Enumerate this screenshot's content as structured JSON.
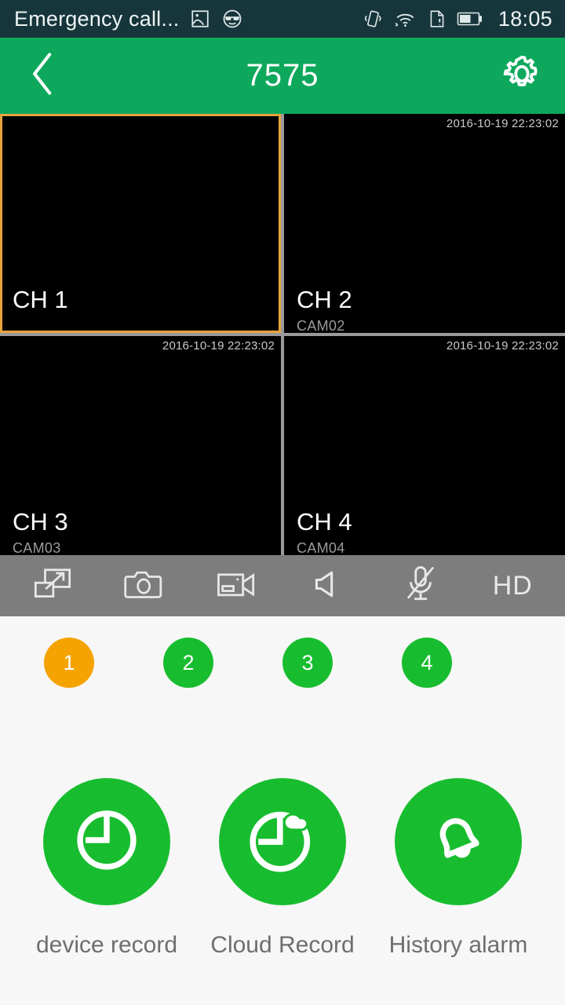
{
  "status_bar": {
    "carrier": "Emergency call...",
    "time": "18:05",
    "left_icons": [
      "photo-icon",
      "sunglasses-face-icon"
    ],
    "right_icons": [
      "vibrate-icon",
      "wifi-icon",
      "no-sim-icon",
      "battery-icon"
    ],
    "background": "#17363b"
  },
  "app_bar": {
    "back_icon": "chevron-left-icon",
    "title": "7575",
    "settings_icon": "gear-icon",
    "background": "#0da85c"
  },
  "video_grid": {
    "cells": [
      {
        "channel": "CH 1",
        "cam": "",
        "timestamp": "",
        "selected": true
      },
      {
        "channel": "CH 2",
        "cam": "CAM02",
        "timestamp": "2016-10-19 22:23:02",
        "selected": false
      },
      {
        "channel": "CH 3",
        "cam": "CAM03",
        "timestamp": "2016-10-19 22:23:02",
        "selected": false
      },
      {
        "channel": "CH 4",
        "cam": "CAM04",
        "timestamp": "2016-10-19 22:23:02",
        "selected": false
      }
    ],
    "selected_border_color": "#e8a33d",
    "gap_color": "#9a9a9a"
  },
  "control_bar": {
    "background": "#7d7d7d",
    "items": [
      {
        "icon": "fullscreen-expand-icon",
        "label": ""
      },
      {
        "icon": "camera-snapshot-icon",
        "label": ""
      },
      {
        "icon": "video-record-icon",
        "label": ""
      },
      {
        "icon": "speaker-icon",
        "label": ""
      },
      {
        "icon": "microphone-muted-icon",
        "label": ""
      },
      {
        "icon": "hd-quality-icon",
        "label": "HD"
      }
    ]
  },
  "channel_selector": {
    "channels": [
      {
        "label": "1",
        "color": "#f5a300",
        "active": true
      },
      {
        "label": "2",
        "color": "#18bd2f",
        "active": false
      },
      {
        "label": "3",
        "color": "#18bd2f",
        "active": false
      },
      {
        "label": "4",
        "color": "#18bd2f",
        "active": false
      }
    ]
  },
  "actions": {
    "accent_color": "#18bd2f",
    "items": [
      {
        "icon": "clock-icon",
        "label": "device record"
      },
      {
        "icon": "cloud-clock-icon",
        "label": "Cloud Record"
      },
      {
        "icon": "bell-icon",
        "label": "History alarm"
      }
    ]
  }
}
